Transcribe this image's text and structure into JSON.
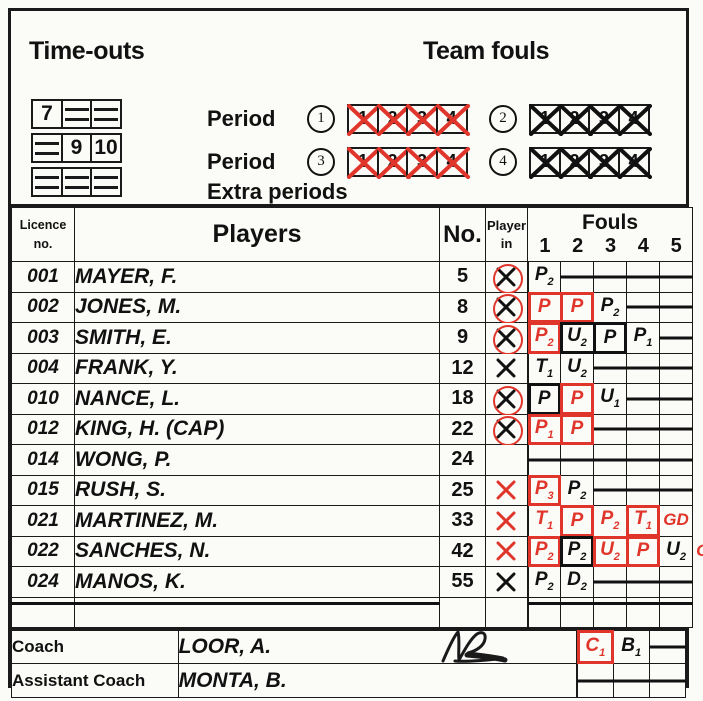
{
  "header": {
    "timeouts_title": "Time-outs",
    "team_fouls_title": "Team fouls",
    "period_label": "Period",
    "extra_periods_label": "Extra periods",
    "period_markers": [
      "①",
      "②",
      "③",
      "④"
    ],
    "period_numbers": [
      "1",
      "2",
      "3",
      "4"
    ],
    "foul_box_numbers": [
      "1",
      "2",
      "3",
      "4"
    ],
    "timeouts": {
      "rows": [
        {
          "cells": [
            "7",
            "",
            ""
          ]
        },
        {
          "cells": [
            "",
            "9",
            "10"
          ]
        },
        {
          "cells": [
            "",
            "",
            ""
          ]
        }
      ]
    },
    "team_fouls": [
      {
        "period": "1",
        "marker": "①",
        "marks": [
          "x",
          "x",
          "x",
          "x"
        ],
        "color": "#e0352b"
      },
      {
        "period": "2",
        "marker": "②",
        "marks": [
          "x",
          "x",
          "x",
          "x"
        ],
        "color": "#111111"
      },
      {
        "period": "3",
        "marker": "③",
        "marks": [
          "x",
          "x",
          "x",
          "x"
        ],
        "color": "#e0352b"
      },
      {
        "period": "4",
        "marker": "④",
        "marks": [
          "x",
          "x",
          "x",
          "x"
        ],
        "color": "#111111"
      }
    ]
  },
  "table": {
    "headers": {
      "licence": "Licence",
      "licence2": "no.",
      "players": "Players",
      "number": "No.",
      "player_in": "Player",
      "player_in2": "in",
      "fouls": "Fouls",
      "foul_cols": [
        "1",
        "2",
        "3",
        "4",
        "5"
      ]
    },
    "rows": [
      {
        "licence": "001",
        "name": "MAYER, F.",
        "no": "5",
        "in": "circled-x",
        "fouls": [
          {
            "t": "P",
            "s": "2",
            "c": "blk"
          },
          {
            "t": "-"
          },
          {
            "t": "-"
          },
          {
            "t": "-"
          },
          {
            "t": "-"
          }
        ]
      },
      {
        "licence": "002",
        "name": "JONES, M.",
        "no": "8",
        "in": "circled-x",
        "fouls": [
          {
            "t": "P",
            "s": "",
            "c": "red",
            "box": "red"
          },
          {
            "t": "P",
            "s": "",
            "c": "red",
            "box": "red",
            "join": true
          },
          {
            "t": "P",
            "s": "2",
            "c": "blk"
          },
          {
            "t": "-"
          },
          {
            "t": "-"
          }
        ]
      },
      {
        "licence": "003",
        "name": "SMITH, E.",
        "no": "9",
        "in": "circled-x",
        "fouls": [
          {
            "t": "P",
            "s": "2",
            "c": "red",
            "box": "red"
          },
          {
            "t": "U",
            "s": "2",
            "c": "blk",
            "box": "blk"
          },
          {
            "t": "P",
            "s": "",
            "c": "blk",
            "box": "blk",
            "join": true
          },
          {
            "t": "P",
            "s": "1",
            "c": "blk"
          },
          {
            "t": "-"
          }
        ]
      },
      {
        "licence": "004",
        "name": "FRANK, Y.",
        "no": "12",
        "in": "x",
        "fouls": [
          {
            "t": "T",
            "s": "1",
            "c": "blk"
          },
          {
            "t": "U",
            "s": "2",
            "c": "blk"
          },
          {
            "t": "-"
          },
          {
            "t": "-"
          },
          {
            "t": "-"
          }
        ]
      },
      {
        "licence": "010",
        "name": "NANCE, L.",
        "no": "18",
        "in": "circled-x",
        "fouls": [
          {
            "t": "P",
            "s": "",
            "c": "blk",
            "box": "blk"
          },
          {
            "t": "P",
            "s": "",
            "c": "red",
            "box": "red"
          },
          {
            "t": "U",
            "s": "1",
            "c": "blk"
          },
          {
            "t": "-"
          },
          {
            "t": "-"
          }
        ]
      },
      {
        "licence": "012",
        "name": "KING, H. (CAP)",
        "no": "22",
        "in": "circled-x",
        "fouls": [
          {
            "t": "P",
            "s": "1",
            "c": "red",
            "box": "red"
          },
          {
            "t": "P",
            "s": "",
            "c": "red",
            "box": "red",
            "join": true
          },
          {
            "t": "-"
          },
          {
            "t": "-"
          },
          {
            "t": "-"
          }
        ]
      },
      {
        "licence": "014",
        "name": "WONG, P.",
        "no": "24",
        "in": "",
        "fouls": [
          {
            "t": "-"
          },
          {
            "t": "-"
          },
          {
            "t": "-"
          },
          {
            "t": "-"
          },
          {
            "t": "-"
          }
        ]
      },
      {
        "licence": "015",
        "name": "RUSH, S.",
        "no": "25",
        "in": "x-red",
        "fouls": [
          {
            "t": "P",
            "s": "3",
            "c": "red",
            "box": "red"
          },
          {
            "t": "P",
            "s": "2",
            "c": "blk"
          },
          {
            "t": "-"
          },
          {
            "t": "-"
          },
          {
            "t": "-"
          }
        ]
      },
      {
        "licence": "021",
        "name": "MARTINEZ, M.",
        "no": "33",
        "in": "x-red",
        "fouls": [
          {
            "t": "T",
            "s": "1",
            "c": "red"
          },
          {
            "t": "P",
            "s": "",
            "c": "red",
            "box": "red"
          },
          {
            "t": "P",
            "s": "2",
            "c": "red"
          },
          {
            "t": "T",
            "s": "1",
            "c": "red",
            "box": "red"
          },
          {
            "t": "GD",
            "s": "",
            "c": "red"
          }
        ]
      },
      {
        "licence": "022",
        "name": "SANCHES, N.",
        "no": "42",
        "in": "x-red",
        "fouls": [
          {
            "t": "P",
            "s": "2",
            "c": "red",
            "box": "red"
          },
          {
            "t": "P",
            "s": "2",
            "c": "blk",
            "box": "blk"
          },
          {
            "t": "U",
            "s": "2",
            "c": "red",
            "box": "red"
          },
          {
            "t": "P",
            "s": "",
            "c": "red",
            "box": "red",
            "join": true
          },
          {
            "t": "U",
            "s": "2",
            "c": "blk"
          }
        ],
        "outside": "GD"
      },
      {
        "licence": "024",
        "name": "MANOS, K.",
        "no": "55",
        "in": "x",
        "fouls": [
          {
            "t": "P",
            "s": "2",
            "c": "blk"
          },
          {
            "t": "D",
            "s": "2",
            "c": "blk"
          },
          {
            "t": "-"
          },
          {
            "t": "-"
          },
          {
            "t": "-"
          }
        ]
      }
    ]
  },
  "coach_section": {
    "coach_label": "Coach",
    "coach_name": "LOOR, A.",
    "coach_fouls": [
      {
        "t": "C",
        "s": "1",
        "c": "red",
        "box": "red"
      },
      {
        "t": "B",
        "s": "1",
        "c": "blk"
      },
      {
        "t": "-"
      }
    ],
    "assistant_label": "Assistant Coach",
    "assistant_name": "MONTA, B.",
    "assistant_fouls": [
      {
        "t": "-"
      },
      {
        "t": "-"
      },
      {
        "t": "-"
      }
    ]
  },
  "colors": {
    "red": "#e0352b",
    "black": "#111111",
    "paper": "#fbfbf8"
  }
}
